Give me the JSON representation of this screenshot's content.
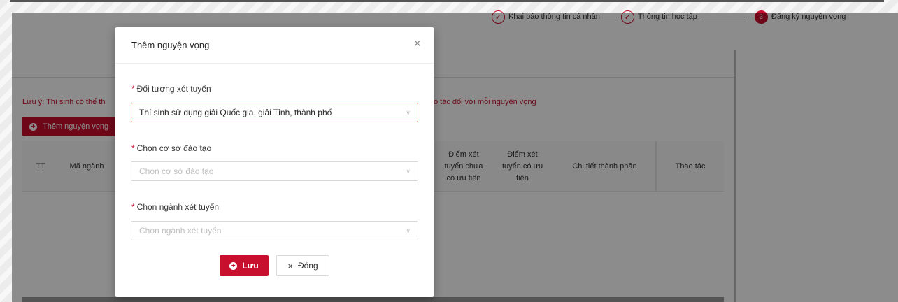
{
  "steps": [
    {
      "label": "Khai báo thông tin cá nhân",
      "state": "done",
      "icon": "check-icon"
    },
    {
      "label": "Thông tin học tập",
      "state": "done",
      "icon": "check-icon"
    },
    {
      "label": "Đăng ký nguyện vọng",
      "state": "active",
      "number": "3"
    }
  ],
  "page": {
    "note_left": "Lưu ý: Thí sinh có thể th",
    "note_right": "o tác đối với mỗi nguyện vọng",
    "add_button": "Thêm nguyện vọng",
    "table_headers": {
      "tt": "TT",
      "ma_nganh": "Mã ngành",
      "diem_chua_uu_tien": "Điểm xét tuyển chưa có ưu tiên",
      "diem_co_uu_tien": "Điểm xét tuyển có ưu tiên",
      "chi_tiet": "Chi tiết thành phần",
      "thao_tac": "Thao tác"
    }
  },
  "modal": {
    "title": "Thêm nguyện vọng",
    "close_icon": "×",
    "fields": [
      {
        "label": "Đối tượng xét tuyển",
        "value": "Thí sinh sử dụng giải Quốc gia, giải Tỉnh, thành phố",
        "placeholder": ""
      },
      {
        "label": "Chọn cơ sở đào tạo",
        "value": "",
        "placeholder": "Chọn cơ sở đào tạo"
      },
      {
        "label": "Chọn ngành xét tuyển",
        "value": "",
        "placeholder": "Chọn ngành xét tuyển"
      }
    ],
    "required_mark": "*",
    "save_label": "Lưu",
    "close_label": "Đóng"
  },
  "colors": {
    "accent": "#c8102e",
    "border": "#d9d9d9",
    "placeholder": "#bfbfbf"
  }
}
